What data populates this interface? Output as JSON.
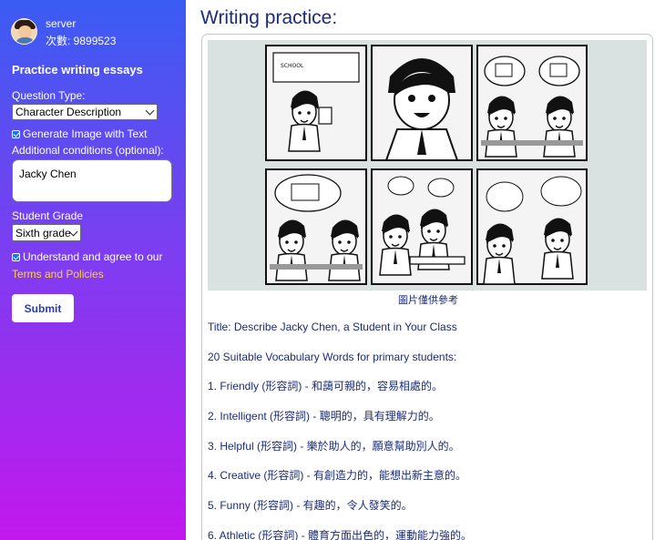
{
  "sidebar": {
    "user": {
      "name": "server",
      "credits_label": "次數: 9899523"
    },
    "heading": "Practice writing essays",
    "question_type": {
      "label": "Question Type:",
      "selected": "Character Description"
    },
    "generate_image": {
      "label": "Generate Image with Text",
      "checked": true
    },
    "additional_conditions": {
      "label": "Additional conditions (optional):",
      "value": "Jacky Chen"
    },
    "grade": {
      "label": "Student Grade",
      "selected": "Sixth grade"
    },
    "agree": {
      "label": "Understand and agree to our",
      "checked": true,
      "link": "Terms and Policies"
    },
    "submit_label": "Submit",
    "colors": {
      "gradient_top": "#3a5cf2",
      "gradient_bottom": "#c218ee",
      "link": "#ffd23a"
    }
  },
  "main": {
    "title": "Writing practice:",
    "image_caption": "圖片僅供參考",
    "lines": [
      "Title: Describe Jacky Chen, a Student in Your Class",
      "20 Suitable Vocabulary Words for primary students:",
      "1. Friendly (形容詞) - 和藹可親的，容易相處的。",
      "2. Intelligent (形容詞) - 聰明的，具有理解力的。",
      "3. Helpful (形容詞) - 樂於助人的，願意幫助別人的。",
      "4. Creative (形容詞) - 有創造力的，能想出新主意的。",
      "5. Funny (形容詞) - 有趣的，令人發笑的。",
      "6. Athletic (形容詞) - 體育方面出色的，運動能力強的。"
    ],
    "comic_sign": "SCHOOL",
    "colors": {
      "title": "#1b2c7a"
    }
  }
}
